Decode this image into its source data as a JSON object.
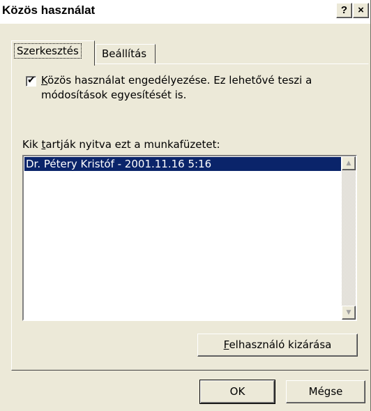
{
  "window": {
    "title": "Közös használat",
    "help_glyph": "?",
    "close_glyph": "×"
  },
  "tabs": [
    {
      "label": "Szerkesztés",
      "active": true
    },
    {
      "label": "Beállítás",
      "active": false
    }
  ],
  "sharing": {
    "checkbox_checked": true,
    "checkbox_mark": "✔",
    "checkbox_label_accel": "K",
    "checkbox_label_rest": "özös használat engedélyezése. Ez lehetővé teszi a módosítások egyesítését is."
  },
  "users_list": {
    "caption_pre": "Kik ",
    "caption_accel": "t",
    "caption_post": "artják nyitva ezt a munkafüzetet:",
    "items": [
      "Dr. Pétery Kristóf - 2001.11.16 5:16"
    ],
    "scroll_up_glyph": "▲",
    "scroll_down_glyph": "▼"
  },
  "buttons": {
    "remove_accel": "F",
    "remove_rest": "elhasználó kizárása",
    "ok": "OK",
    "cancel": "Mégse"
  },
  "colors": {
    "dialog_bg": "#ece9d8",
    "selection_bg": "#0a246a",
    "selection_fg": "#ffffff"
  }
}
